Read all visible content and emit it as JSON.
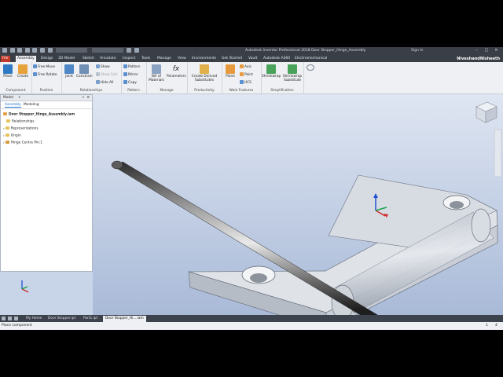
{
  "window": {
    "title": "Autodesk Inventor Professional 2018   Door Stopper_Hinge_Assembly",
    "signin": "Sign In"
  },
  "tabs": [
    "File",
    "Assembly",
    "Design",
    "3D Model",
    "Sketch",
    "Annotate",
    "Inspect",
    "Tools",
    "Manage",
    "View",
    "Environments",
    "Get Started",
    "Vault",
    "Autodesk A360",
    "Electromechanical"
  ],
  "active_tab": "Assembly",
  "username": "NiveshandNisheeth",
  "ribbon": {
    "component": {
      "label": "Component",
      "place": "Place",
      "create": "Create"
    },
    "position": {
      "label": "Position",
      "free_move": "Free Move",
      "free_rotate": "Free Rotate"
    },
    "relationships": {
      "label": "Relationships",
      "joint": "Joint",
      "constrain": "Constrain",
      "show": "Show",
      "show_sick": "Show Sick",
      "hide_all": "Hide All"
    },
    "pattern": {
      "label": "Pattern",
      "pattern": "Pattern",
      "mirror": "Mirror",
      "copy": "Copy"
    },
    "manage": {
      "label": "Manage",
      "bom": "Bill of Materials",
      "parameters": "Parameters"
    },
    "productivity": {
      "label": "Productivity",
      "create_derived": "Create Derived Substitutes"
    },
    "work_features": {
      "label": "Work Features",
      "plane": "Plane",
      "axis": "Axis",
      "point": "Point",
      "ucs": "UCS"
    },
    "simplification": {
      "label": "Simplification",
      "shrinkwrap": "Shrinkwrap",
      "shrinkwrap_sub": "Shrinkwrap Substitute"
    }
  },
  "browser": {
    "title": "Model",
    "tabs": [
      "Assembly",
      "Modeling"
    ],
    "root": "Door Stopper_Hinge_Assembly.iam",
    "items": [
      "Relationships",
      "Representations",
      "Origin",
      "Hinge Centre Pin:1"
    ]
  },
  "doc_tabs": [
    "My Home",
    "Door Stopper.ipt",
    "Part1.ipt",
    "Door Stopper_Hi....iam"
  ],
  "status": {
    "text": "Place component",
    "n1": "1",
    "n2": "4"
  },
  "colors": {
    "file_tab": "#c0392b",
    "accent": "#1f6fd1",
    "viewport_bg": "#c8d4e8"
  }
}
